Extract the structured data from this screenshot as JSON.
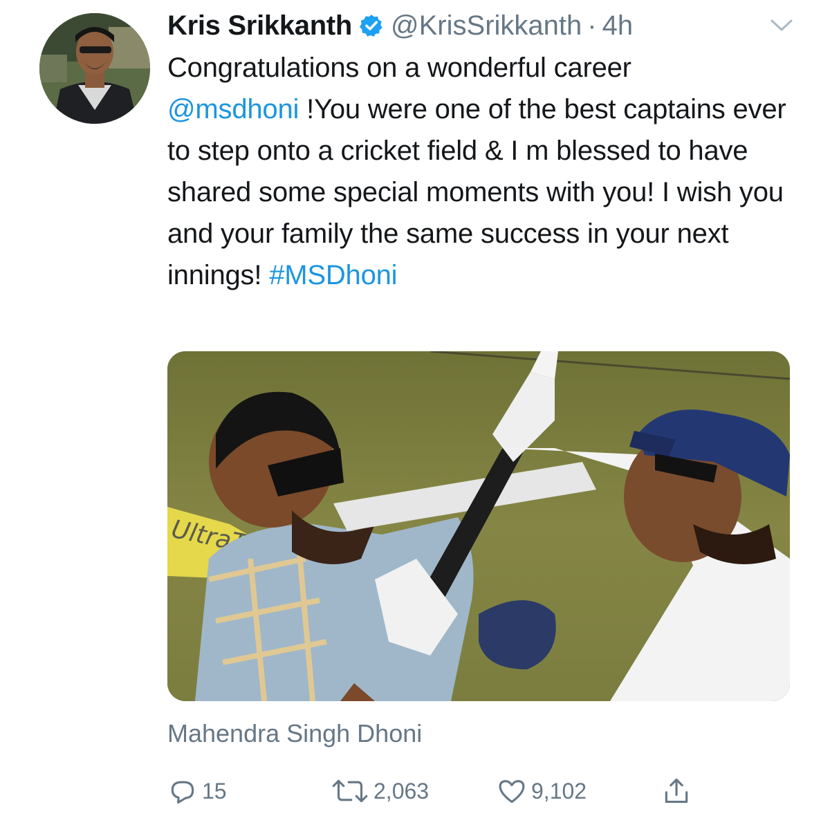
{
  "tweet": {
    "author": {
      "display_name": "Kris Srikkanth",
      "handle": "@KrisSrikkanth",
      "separator": "·",
      "time": "4h",
      "verified": true
    },
    "text": {
      "part1": "Congratulations on a wonderful career",
      "mention": "@msdhoni",
      "part2": " !You were one of the best captains ever to step onto a cricket field & I m blessed to have shared some special moments with you! I wish you and your family the same success in your next innings! ",
      "hashtag": "#MSDhoni"
    },
    "media": {
      "caption": "Mahendra Singh Dhoni",
      "photo_text": "UltraTe"
    },
    "actions": {
      "reply_count": "15",
      "retweet_count": "2,063",
      "like_count": "9,102"
    },
    "icons": {
      "verified": "verified-badge-icon",
      "caret": "chevron-down-icon",
      "reply": "reply-icon",
      "retweet": "retweet-icon",
      "like": "heart-icon",
      "share": "share-icon"
    },
    "colors": {
      "link": "#1b95e0",
      "muted": "#657786",
      "text": "#14171a",
      "verified": "#1da1f2"
    }
  }
}
